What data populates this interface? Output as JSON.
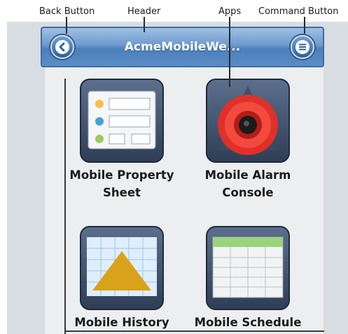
{
  "callouts": {
    "back": "Back Button",
    "header": "Header",
    "apps": "Apps",
    "command": "Command Button"
  },
  "header": {
    "title": "AcmeMobileWe..."
  },
  "apps": [
    {
      "label_line1": "Mobile Property",
      "label_line2": "Sheet",
      "icon": "property-sheet-icon"
    },
    {
      "label_line1": "Mobile Alarm",
      "label_line2": "Console",
      "icon": "alarm-console-icon"
    },
    {
      "label_line1": "Mobile History",
      "label_line2": "",
      "icon": "history-chart-icon"
    },
    {
      "label_line1": "Mobile Schedule",
      "label_line2": "",
      "icon": "schedule-grid-icon"
    }
  ],
  "colors": {
    "header_blue": "#5b8cc6",
    "alarm_red": "#e0302a",
    "history_gold": "#d9a21b",
    "schedule_green": "#9bd47a"
  }
}
